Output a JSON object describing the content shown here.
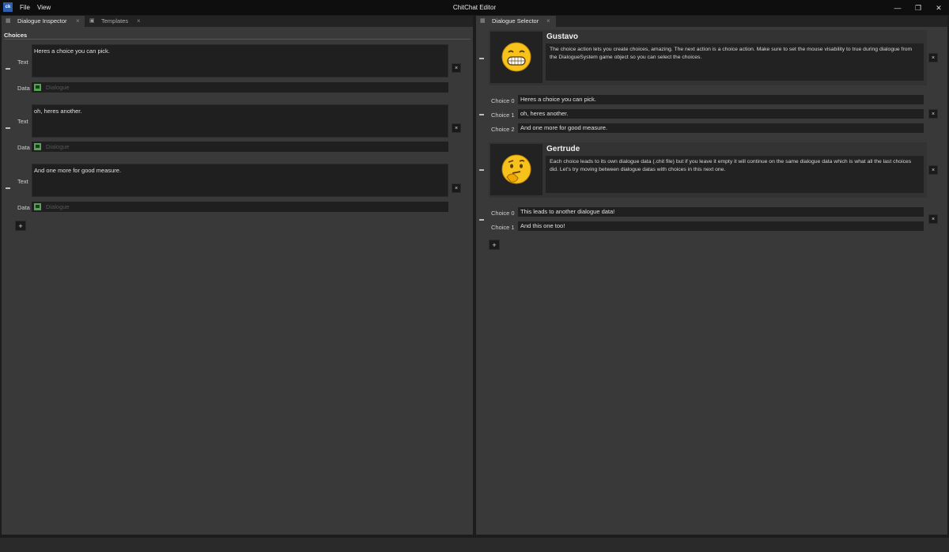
{
  "app": {
    "icon_text": "ck",
    "title": "ChitChat Editor"
  },
  "menu": [
    "File",
    "View"
  ],
  "window_controls": {
    "minimize": "—",
    "maximize": "❐",
    "close": "✕"
  },
  "left_panel": {
    "tabs": [
      {
        "icon": "grid-icon",
        "label": "Dialogue Inspector",
        "close": "×",
        "active": true
      },
      {
        "icon": "template-icon",
        "label": "Templates",
        "close": "×",
        "active": false
      }
    ],
    "section_title": "Choices",
    "choices": [
      {
        "text_label": "Text",
        "text": "Heres a choice you can pick.",
        "data_label": "Data",
        "data_placeholder": "Dialogue"
      },
      {
        "text_label": "Text",
        "text": "oh, heres another.",
        "data_label": "Data",
        "data_placeholder": "Dialogue"
      },
      {
        "text_label": "Text",
        "text": "And one more for good measure.",
        "data_label": "Data",
        "data_placeholder": "Dialogue"
      }
    ],
    "remove_label": "×",
    "add_label": "+"
  },
  "right_panel": {
    "tab": {
      "icon": "grid-icon",
      "label": "Dialogue Selector",
      "close": "×"
    },
    "entries": [
      {
        "speaker": "Gustavo",
        "emoji": "grinning-face",
        "text": "The choice action lets you create choices, amazing. The next action is a choice action. Make sure to set the mouse visability to true during dialogue from the DialogueSystem game object so you can select the choices.",
        "choices": [
          {
            "label": "Choice 0",
            "value": "Heres a choice you can pick."
          },
          {
            "label": "Choice 1",
            "value": "oh, heres another."
          },
          {
            "label": "Choice 2",
            "value": "And one more for good measure."
          }
        ]
      },
      {
        "speaker": "Gertrude",
        "emoji": "thinking-face",
        "text": "Each choice leads to its own dialogue data (.chit file) but if you leave it empty it will continue on the same dialogue data which is what all the last choices did. Let's try moving between dialogue datas with choices in this next one.",
        "choices": [
          {
            "label": "Choice 0",
            "value": "This leads to another dialogue data!"
          },
          {
            "label": "Choice 1",
            "value": "And this one too!"
          }
        ]
      }
    ],
    "remove_label": "×",
    "add_label": "+"
  }
}
